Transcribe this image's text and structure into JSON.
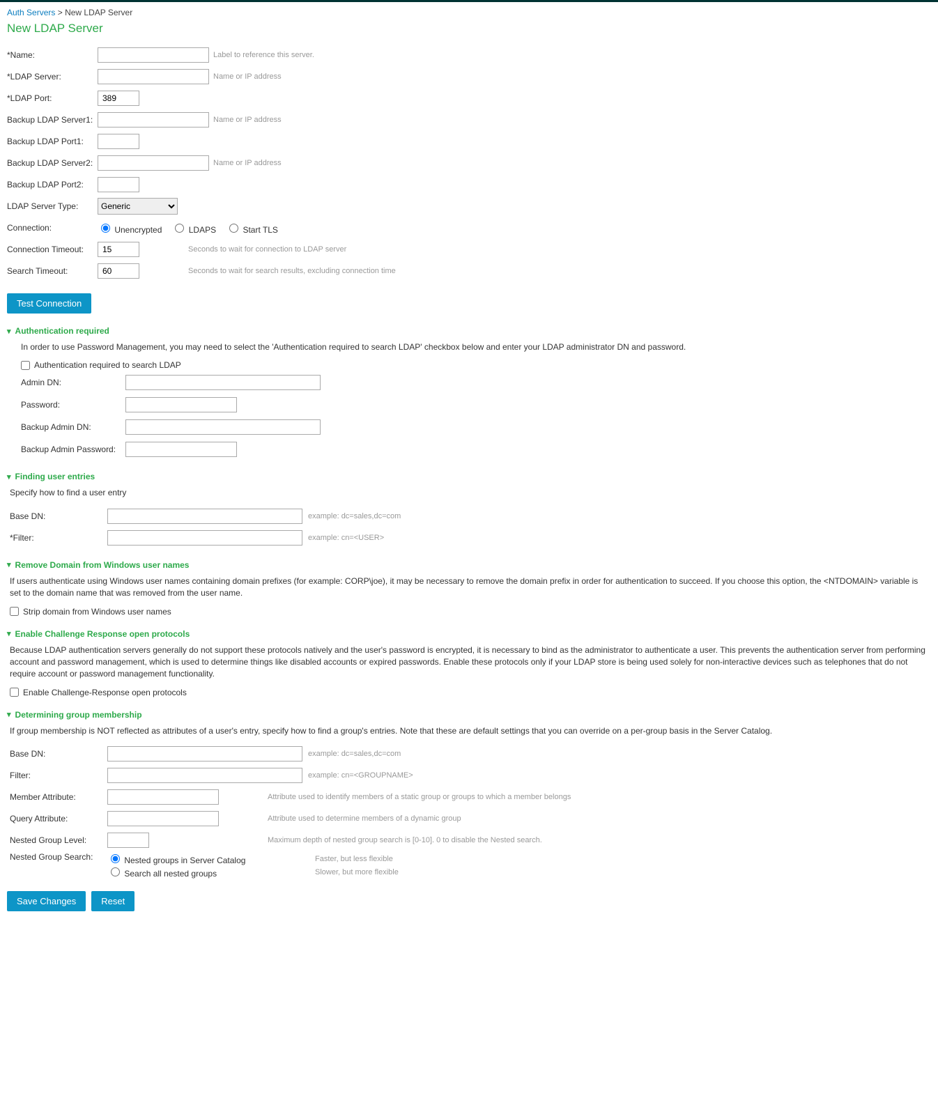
{
  "breadcrumb": {
    "root": "Auth Servers",
    "current": "New LDAP Server"
  },
  "page_title": "New LDAP Server",
  "fields": {
    "name": {
      "label": "*Name:",
      "value": "",
      "hint": "Label to reference this server."
    },
    "ldap_server": {
      "label": "*LDAP Server:",
      "value": "",
      "hint": "Name or IP address"
    },
    "ldap_port": {
      "label": "*LDAP Port:",
      "value": "389"
    },
    "backup1_server": {
      "label": "Backup LDAP Server1:",
      "value": "",
      "hint": "Name or IP address"
    },
    "backup1_port": {
      "label": "Backup LDAP Port1:",
      "value": ""
    },
    "backup2_server": {
      "label": "Backup LDAP Server2:",
      "value": "",
      "hint": "Name or IP address"
    },
    "backup2_port": {
      "label": "Backup LDAP Port2:",
      "value": ""
    },
    "server_type": {
      "label": "LDAP Server Type:",
      "value": "Generic"
    },
    "connection": {
      "label": "Connection:",
      "options": {
        "unenc": "Unencrypted",
        "ldaps": "LDAPS",
        "starttls": "Start TLS"
      }
    },
    "conn_timeout": {
      "label": "Connection Timeout:",
      "value": "15",
      "hint": "Seconds to wait for connection to LDAP server"
    },
    "search_timeout": {
      "label": "Search Timeout:",
      "value": "60",
      "hint": "Seconds to wait for search results, excluding connection time"
    }
  },
  "buttons": {
    "test": "Test Connection",
    "save": "Save Changes",
    "reset": "Reset"
  },
  "auth_req": {
    "title": "Authentication required",
    "desc": "In order to use Password Management, you may need to select the 'Authentication required to search LDAP' checkbox below and enter your LDAP administrator DN and password.",
    "checkbox": "Authentication required to search LDAP",
    "admin_dn": {
      "label": "Admin DN:",
      "value": ""
    },
    "password": {
      "label": "Password:",
      "value": ""
    },
    "backup_admin_dn": {
      "label": "Backup Admin DN:",
      "value": ""
    },
    "backup_admin_pw": {
      "label": "Backup Admin Password:",
      "value": ""
    }
  },
  "find_user": {
    "title": "Finding user entries",
    "desc": "Specify how to find a user entry",
    "base_dn": {
      "label": "Base DN:",
      "value": "",
      "hint": "example: dc=sales,dc=com"
    },
    "filter": {
      "label": "*Filter:",
      "value": "",
      "hint": "example: cn=<USER>"
    }
  },
  "remove_domain": {
    "title": "Remove Domain from Windows user names",
    "desc": "If users authenticate using Windows user names containing domain prefixes (for example: CORP\\joe), it may be necessary to remove the domain prefix in order for authentication to succeed. If you choose this option, the <NTDOMAIN> variable is set to the domain name that was removed from the user name.",
    "checkbox": "Strip domain from Windows user names"
  },
  "challenge": {
    "title": "Enable Challenge Response open protocols",
    "desc": "Because LDAP authentication servers generally do not support these protocols natively and the user's password is encrypted, it is necessary to bind as the administrator to authenticate a user. This prevents the authentication server from performing account and password management, which is used to determine things like disabled accounts or expired passwords. Enable these protocols only if your LDAP store is being used solely for non-interactive devices such as telephones that do not require account or password management functionality.",
    "checkbox": "Enable Challenge-Response open protocols"
  },
  "group": {
    "title": "Determining group membership",
    "desc": "If group membership is NOT reflected as attributes of a user's entry, specify how to find a group's entries. Note that these are default settings that you can override on a per-group basis in the Server Catalog.",
    "base_dn": {
      "label": "Base DN:",
      "value": "",
      "hint": "example: dc=sales,dc=com"
    },
    "filter": {
      "label": "Filter:",
      "value": "",
      "hint": "example: cn=<GROUPNAME>"
    },
    "member_attr": {
      "label": "Member Attribute:",
      "value": "",
      "hint": "Attribute used to identify members of a static group or groups to which a member belongs"
    },
    "query_attr": {
      "label": "Query Attribute:",
      "value": "",
      "hint": "Attribute used to determine members of a dynamic group"
    },
    "nested_level": {
      "label": "Nested Group Level:",
      "value": "",
      "hint": "Maximum depth of nested group search is [0-10]. 0 to disable the Nested search."
    },
    "nested_search": {
      "label": "Nested Group Search:",
      "opt1": "Nested groups in Server Catalog",
      "hint1": "Faster, but less flexible",
      "opt2": "Search all nested groups",
      "hint2": "Slower, but more flexible"
    }
  }
}
